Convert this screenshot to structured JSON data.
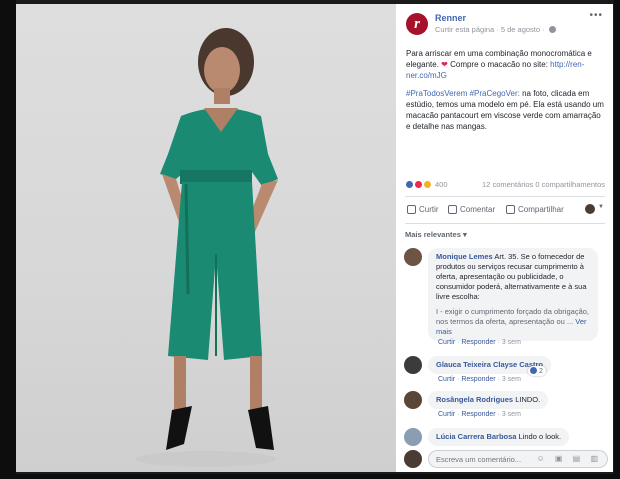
{
  "post": {
    "page_name": "Renner",
    "logo_letter": "r",
    "meta": "Curtir esta página · 5 de agosto ·",
    "paragraph1": "Para arriscar em uma combinação monocromática e elegante.",
    "paragraph1b": " Compre o macacão no site: ",
    "link": "http://ren-ner.co/mJG",
    "hashtags": "#PraTodosVerem #PraCegoVer:",
    "paragraph2": " na foto, clicada em estúdio, temos uma modelo em pé. Ela está usando um macacão pantacourt em viscose verde com amarração e detalhe nas mangas.",
    "heart": "❤",
    "options": "•••"
  },
  "reactions": {
    "count": "400",
    "stats": "12 comentários  0 compartilhamentos"
  },
  "actions": {
    "like": "Curtir",
    "comment": "Comentar",
    "share": "Compartilhar",
    "caret": "▼"
  },
  "filter": "Mais relevantes ▾",
  "comments": [
    {
      "author": "Monique Lemes",
      "text": "Art. 35. Se o fornecedor de produtos ou serviços recusar cumprimento à oferta, apresentação ou publicidade, o consumidor poderá, alternativamente e à sua livre escolha:",
      "faded": "I - exigir o cumprimento forçado da obrigação, nos termos da oferta, apresentação ou ...",
      "see_more": "Ver mais",
      "meta_like": "Curtir",
      "meta_reply": "Responder",
      "meta_time": "3 sem"
    },
    {
      "author": "Glauca Teixeira Clayse Castro",
      "text": "",
      "meta_like": "Curtir",
      "meta_reply": "Responder",
      "meta_time": "3 sem",
      "likes": "2"
    },
    {
      "author": "Rosângela Rodrigues",
      "text": "LINDO.",
      "meta_like": "Curtir",
      "meta_reply": "Responder",
      "meta_time": "3 sem"
    },
    {
      "author": "Lúcia Carrera Barbosa",
      "text": "Lindo o look."
    }
  ],
  "composer": {
    "placeholder": "Escreva um comentário...",
    "icons": "☺ ▣ ▤ ▥"
  },
  "colors": {
    "brand": "#a6122b",
    "link": "#4267b2",
    "jumpsuit": "#1a8a72"
  }
}
